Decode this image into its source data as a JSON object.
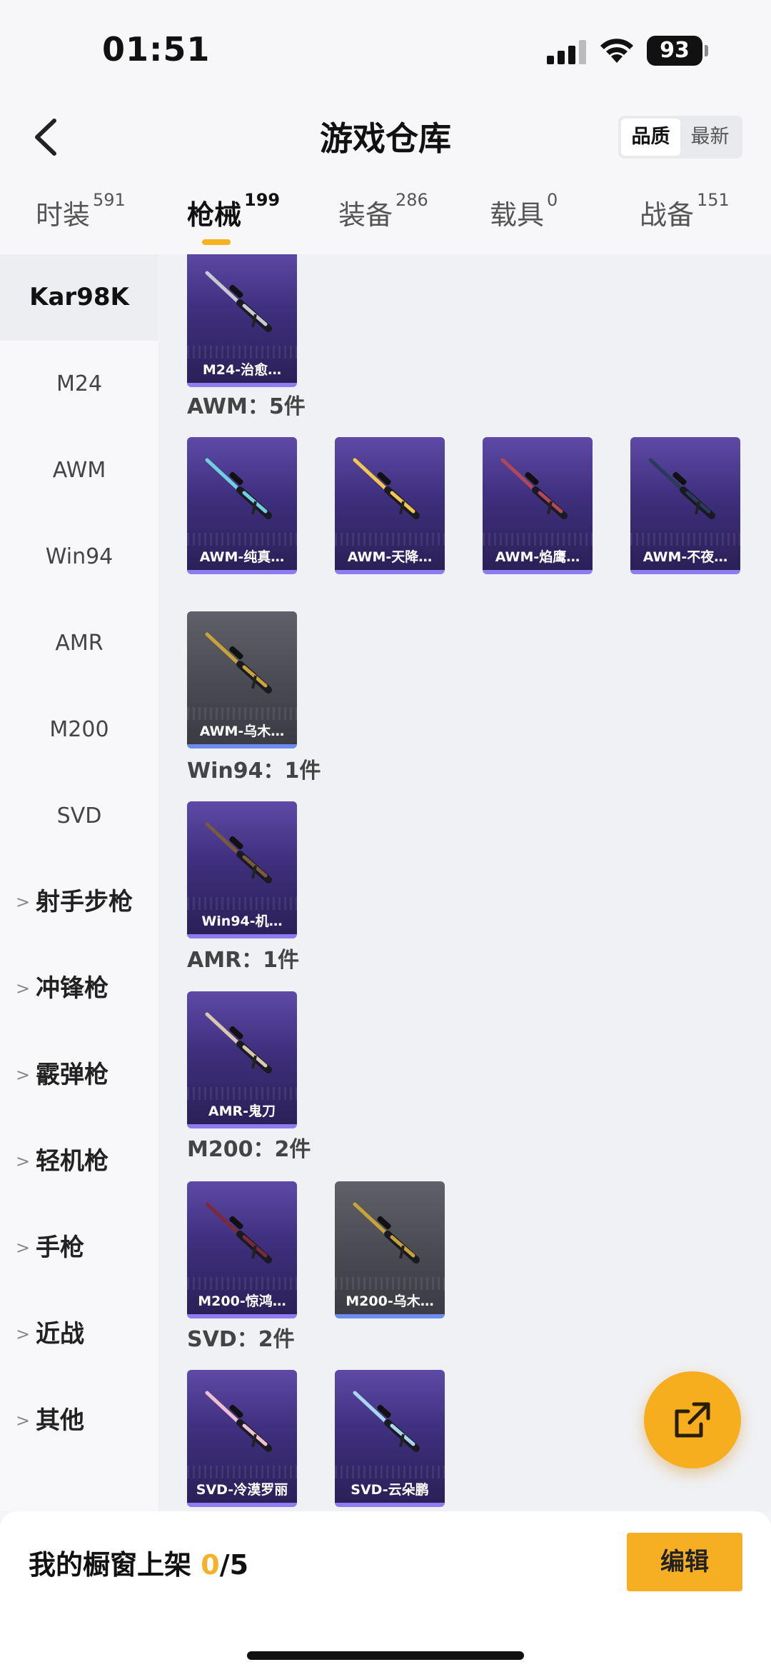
{
  "status_bar": {
    "time": "01:51",
    "battery": "93"
  },
  "header": {
    "title": "游戏仓库",
    "sort_options": [
      "品质",
      "最新"
    ],
    "sort_selected": "品质"
  },
  "tabs": [
    {
      "label": "时装",
      "count": "591"
    },
    {
      "label": "枪械",
      "count": "199",
      "active": true
    },
    {
      "label": "装备",
      "count": "286"
    },
    {
      "label": "载具",
      "count": "0"
    },
    {
      "label": "战备",
      "count": "151"
    }
  ],
  "sidebar": {
    "weapons": [
      "Kar98K",
      "M24",
      "AWM",
      "Win94",
      "AMR",
      "M200",
      "SVD"
    ],
    "selected": "Kar98K",
    "groups": [
      "射手步枪",
      "冲锋枪",
      "霰弹枪",
      "轻机枪",
      "手枪",
      "近战",
      "其他"
    ]
  },
  "sections": [
    {
      "label": "",
      "items": [
        {
          "name": "M24-治愈…",
          "style": "purple"
        }
      ]
    },
    {
      "label": "AWM：5件",
      "items": [
        {
          "name": "AWM-纯真…",
          "style": "purple"
        },
        {
          "name": "AWM-天降…",
          "style": "purple"
        },
        {
          "name": "AWM-焰鹰…",
          "style": "purple"
        },
        {
          "name": "AWM-不夜…",
          "style": "purple"
        },
        {
          "name": "AWM-乌木…",
          "style": "grey"
        }
      ]
    },
    {
      "label": "Win94：1件",
      "items": [
        {
          "name": "Win94-机…",
          "style": "purple"
        }
      ]
    },
    {
      "label": "AMR：1件",
      "items": [
        {
          "name": "AMR-鬼刀",
          "style": "purple"
        }
      ]
    },
    {
      "label": "M200：2件",
      "items": [
        {
          "name": "M200-惊鸿…",
          "style": "purple"
        },
        {
          "name": "M200-乌木…",
          "style": "grey"
        }
      ]
    },
    {
      "label": "SVD：2件",
      "items": [
        {
          "name": "SVD-冷漠罗丽",
          "style": "purple"
        },
        {
          "name": "SVD-云朵鹏",
          "style": "purple"
        }
      ]
    }
  ],
  "bottom_bar": {
    "shelf_label": "我的橱窗上架",
    "shelf_current": "0",
    "shelf_total": "/5",
    "edit_label": "编辑"
  },
  "colors": {
    "accent": "#F6AE1E",
    "card_purple": "#3F2F7E",
    "card_grey": "#474850"
  }
}
